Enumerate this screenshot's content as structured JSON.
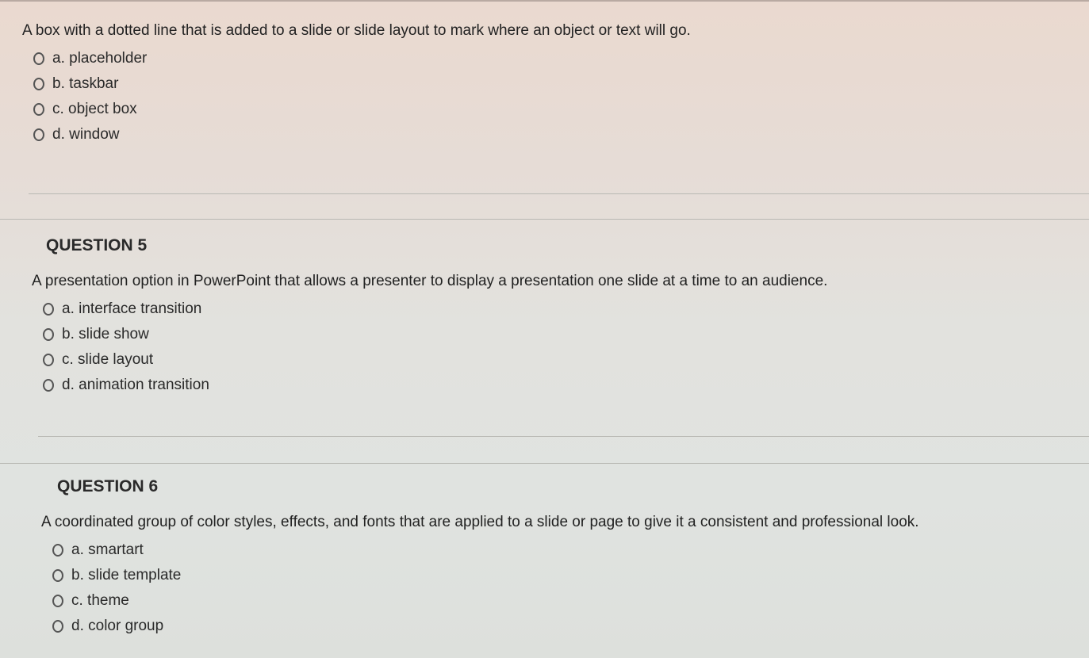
{
  "questions": [
    {
      "title": "",
      "text": "A box with a dotted line that is added to a slide or slide layout to mark where an object or text will go.",
      "options": [
        "a. placeholder",
        "b. taskbar",
        "c. object box",
        "d. window"
      ]
    },
    {
      "title": "QUESTION 5",
      "text": "A presentation option in PowerPoint that allows a presenter to display a presentation one slide at a time to an audience.",
      "options": [
        "a. interface transition",
        "b. slide show",
        "c. slide layout",
        "d. animation transition"
      ]
    },
    {
      "title": "QUESTION 6",
      "text": "A coordinated group of color styles, effects, and fonts that are applied to a slide or page to give it a consistent and professional look.",
      "options": [
        "a. smartart",
        "b. slide template",
        "c. theme",
        "d. color group"
      ]
    }
  ]
}
